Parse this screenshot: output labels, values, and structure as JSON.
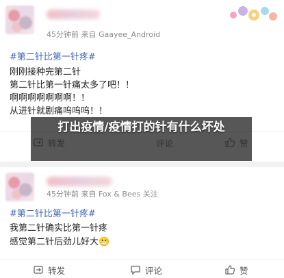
{
  "post1": {
    "meta": "45分钟前  来自 Gaayee_Android",
    "hashtag": "#第二针比第一针疼#",
    "lines": [
      "刚刚接种完第二针",
      "第二针比第一针痛太多了吧！！",
      "啊啊啊啊啊啊啊！！",
      "从进针就剧痛呜呜呜！！"
    ],
    "actions": {
      "repost": "转发",
      "comment": "评论",
      "like": "赞"
    }
  },
  "post2": {
    "meta": "45分钟前  来自 Fox & Bees  关注",
    "hashtag": "#第二针比第一针疼#",
    "lines": [
      "我第二针确实比第一针疼",
      "感觉第二针后劲儿好大😬"
    ],
    "actions": {
      "repost": "转发",
      "comment": "评论",
      "like": "赞"
    }
  },
  "overlay_title": "打出疫情/疫情打的针有什么坏处",
  "icons": [
    "sticker-icon",
    "repost-icon",
    "comment-icon",
    "like-icon"
  ]
}
